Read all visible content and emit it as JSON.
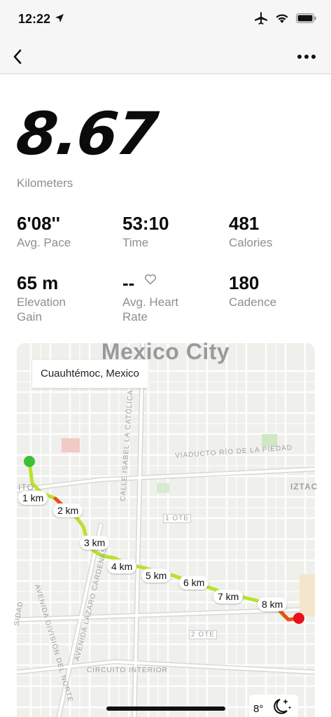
{
  "status_bar": {
    "time": "12:22",
    "icons": [
      "location-arrow-icon",
      "airplane-icon",
      "wifi-icon",
      "battery-icon"
    ]
  },
  "nav": {
    "back_icon": "chevron-left-icon",
    "more_icon": "more-dots-icon"
  },
  "summary": {
    "distance_value": "8.67",
    "distance_unit": "Kilometers"
  },
  "stats": {
    "avg_pace": {
      "value": "6'08''",
      "label": "Avg. Pace"
    },
    "time": {
      "value": "53:10",
      "label": "Time"
    },
    "calories": {
      "value": "481",
      "label": "Calories"
    },
    "elevation": {
      "value": "65 m",
      "label_line1": "Elevation",
      "label_line2": "Gain"
    },
    "heart_rate": {
      "value": "--",
      "label_line1": "Avg. Heart",
      "label_line2": "Rate",
      "icon": "heart-icon"
    },
    "cadence": {
      "value": "180",
      "label": "Cadence"
    }
  },
  "map": {
    "city": "Mexico City",
    "location": "Cuauhtémoc, Mexico",
    "km_markers": [
      "1 km",
      "2 km",
      "3 km",
      "4 km",
      "5 km",
      "6 km",
      "7 km",
      "8 km"
    ],
    "road_labels": {
      "viaducto": "VIADUCTO RÍO DE LA PIEDAD",
      "isabel": "CALLE ISABEL LA CATÓLICA",
      "lazaro": "AVENIDA LÁZARO CÁRDENAS",
      "division": "AVENIDA DIVISIÓN DEL NORTE",
      "circuito": "CIRCUITO INTERIOR",
      "iztac": "IZTAC",
      "ote1": "1 OTE",
      "ote2": "2 OTE",
      "tito": "ITO",
      "sidad": "SIDAD"
    },
    "colors": {
      "start": "#3cc03c",
      "end": "#e8101a",
      "route_fast": "#b8e22c",
      "route_slow": "#e8501a"
    }
  },
  "weather": {
    "temp": "8°",
    "icon": "moon-stars-icon"
  }
}
